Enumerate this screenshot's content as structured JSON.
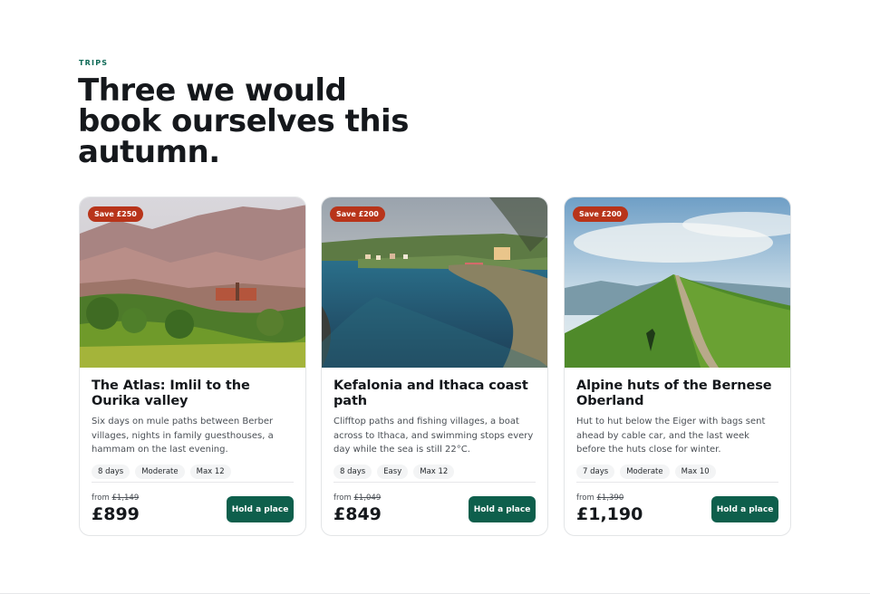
{
  "section": {
    "eyebrow": "TRIPS",
    "headline": "Three we would book ourselves this autumn."
  },
  "cards": [
    {
      "badge": "Save £250",
      "title": "The Atlas: Imlil to the Ourika valley",
      "description": "Six days on mule paths between Berber villages, nights in family guesthouses, a hammam on the last evening.",
      "tags": [
        "8 days",
        "Moderate",
        "Max 12"
      ],
      "from_label": "from",
      "old_price": "£1,149",
      "price": "£899",
      "button": "Hold a place",
      "photo": "atlas-mountain-village-photo"
    },
    {
      "badge": "Save £200",
      "title": "Kefalonia and Ithaca coast path",
      "description": "Clifftop paths and fishing villages, a boat across to Ithaca, and swimming stops every day while the sea is still 22°C.",
      "tags": [
        "8 days",
        "Easy",
        "Max 12"
      ],
      "from_label": "from",
      "old_price": "£1,049",
      "price": "£849",
      "button": "Hold a place",
      "photo": "greek-bay-village-photo"
    },
    {
      "badge": "Save £200",
      "title": "Alpine huts of the Bernese Oberland",
      "description": "Hut to hut below the Eiger with bags sent ahead by cable car, and the last week before the huts close for winter.",
      "tags": [
        "7 days",
        "Moderate",
        "Max 10"
      ],
      "from_label": "from",
      "old_price": "£1,390",
      "price": "£1,190",
      "button": "Hold a place",
      "photo": "alpine-ridge-path-photo"
    }
  ],
  "colors": {
    "accent": "#0e5f4c",
    "eyebrow": "#0f6a57",
    "badge": "#b8341a"
  }
}
